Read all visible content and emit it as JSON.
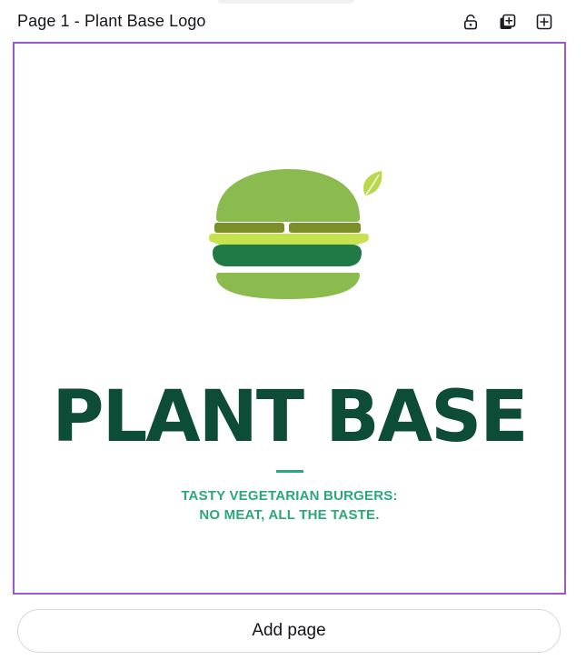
{
  "header": {
    "page_title": "Page 1 - Plant Base Logo",
    "icons": {
      "lock": "unlock-icon",
      "duplicate": "duplicate-page-icon",
      "add": "add-page-icon"
    }
  },
  "canvas": {
    "brand_name": "PLANT BASE",
    "tagline_line1": "TASTY VEGETARIAN BURGERS:",
    "tagline_line2": "NO MEAT, ALL THE TASTE.",
    "colors": {
      "selection_border": "#9b59d6",
      "brand_dark_green": "#0d4d38",
      "tagline_green": "#2aa87a",
      "bun_green": "#8bbb4e",
      "patty_olive": "#7a8f2a",
      "lettuce_lime": "#c6e34f",
      "patty_dark_green": "#1f7a45"
    }
  },
  "footer": {
    "add_page_label": "Add page"
  }
}
